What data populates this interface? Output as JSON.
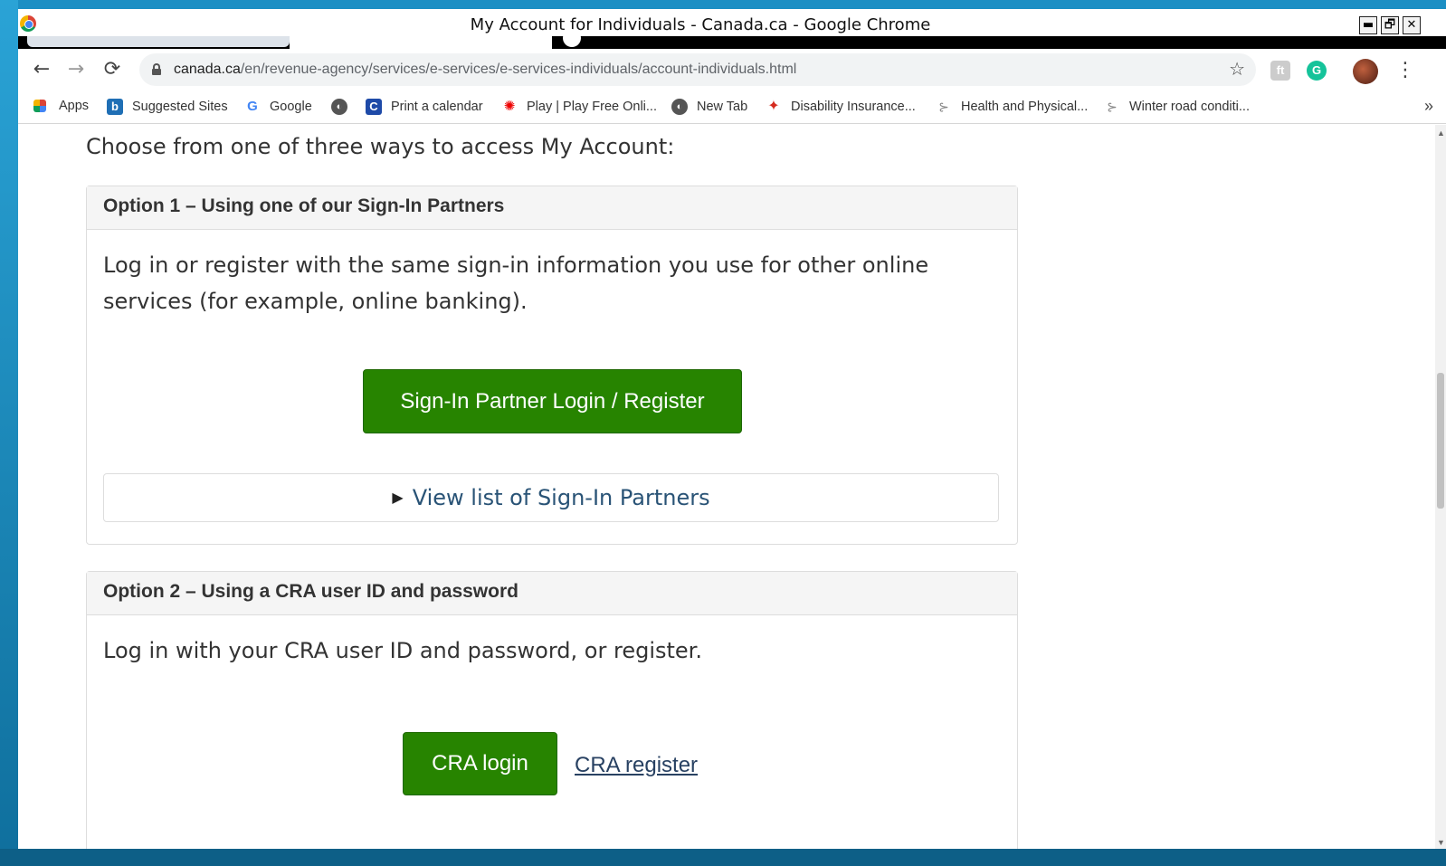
{
  "window": {
    "title": "My Account for Individuals - Canada.ca - Google Chrome",
    "minimize": "▬",
    "restore": "🗗",
    "close": "✕"
  },
  "toolbar": {
    "back": "←",
    "forward": "→",
    "reload": "⟳",
    "url_host": "canada.ca",
    "url_path": "/en/revenue-agency/services/e-services/e-services-individuals/account-individuals.html",
    "star": "☆",
    "menu": "⋮"
  },
  "bookmarks": [
    {
      "label": "Apps",
      "icon": "apps-grid-icon"
    },
    {
      "label": "Suggested Sites",
      "icon": "bing-icon"
    },
    {
      "label": "Google",
      "icon": "google-icon"
    },
    {
      "label": "",
      "icon": "globe-icon"
    },
    {
      "label": "Print a calendar",
      "icon": "calendar-icon"
    },
    {
      "label": "Play | Play Free Onli...",
      "icon": "cbc-icon"
    },
    {
      "label": "New Tab",
      "icon": "globe-icon"
    },
    {
      "label": "Disability Insurance...",
      "icon": "maple-leaf-icon"
    },
    {
      "label": "Health and Physical...",
      "icon": "bookmark-leaf-icon"
    },
    {
      "label": "Winter road conditi...",
      "icon": "bookmark-leaf-icon"
    }
  ],
  "bookmarks_more": "»",
  "page": {
    "intro": "Choose from one of three ways to access My Account:",
    "option1": {
      "heading": "Option 1 – Using one of our Sign-In Partners",
      "text": "Log in or register with the same sign-in information you use for other online services (for example, online banking).",
      "button": "Sign-In Partner Login / Register",
      "details": "View list of Sign-In Partners"
    },
    "option2": {
      "heading": "Option 2 – Using a CRA user ID and password",
      "text": "Log in with your CRA user ID and password, or register.",
      "login_button": "CRA login",
      "register_link": "CRA register"
    }
  },
  "colors": {
    "button_green": "#278400",
    "link": "#284162",
    "panel_header": "#f5f5f5"
  }
}
